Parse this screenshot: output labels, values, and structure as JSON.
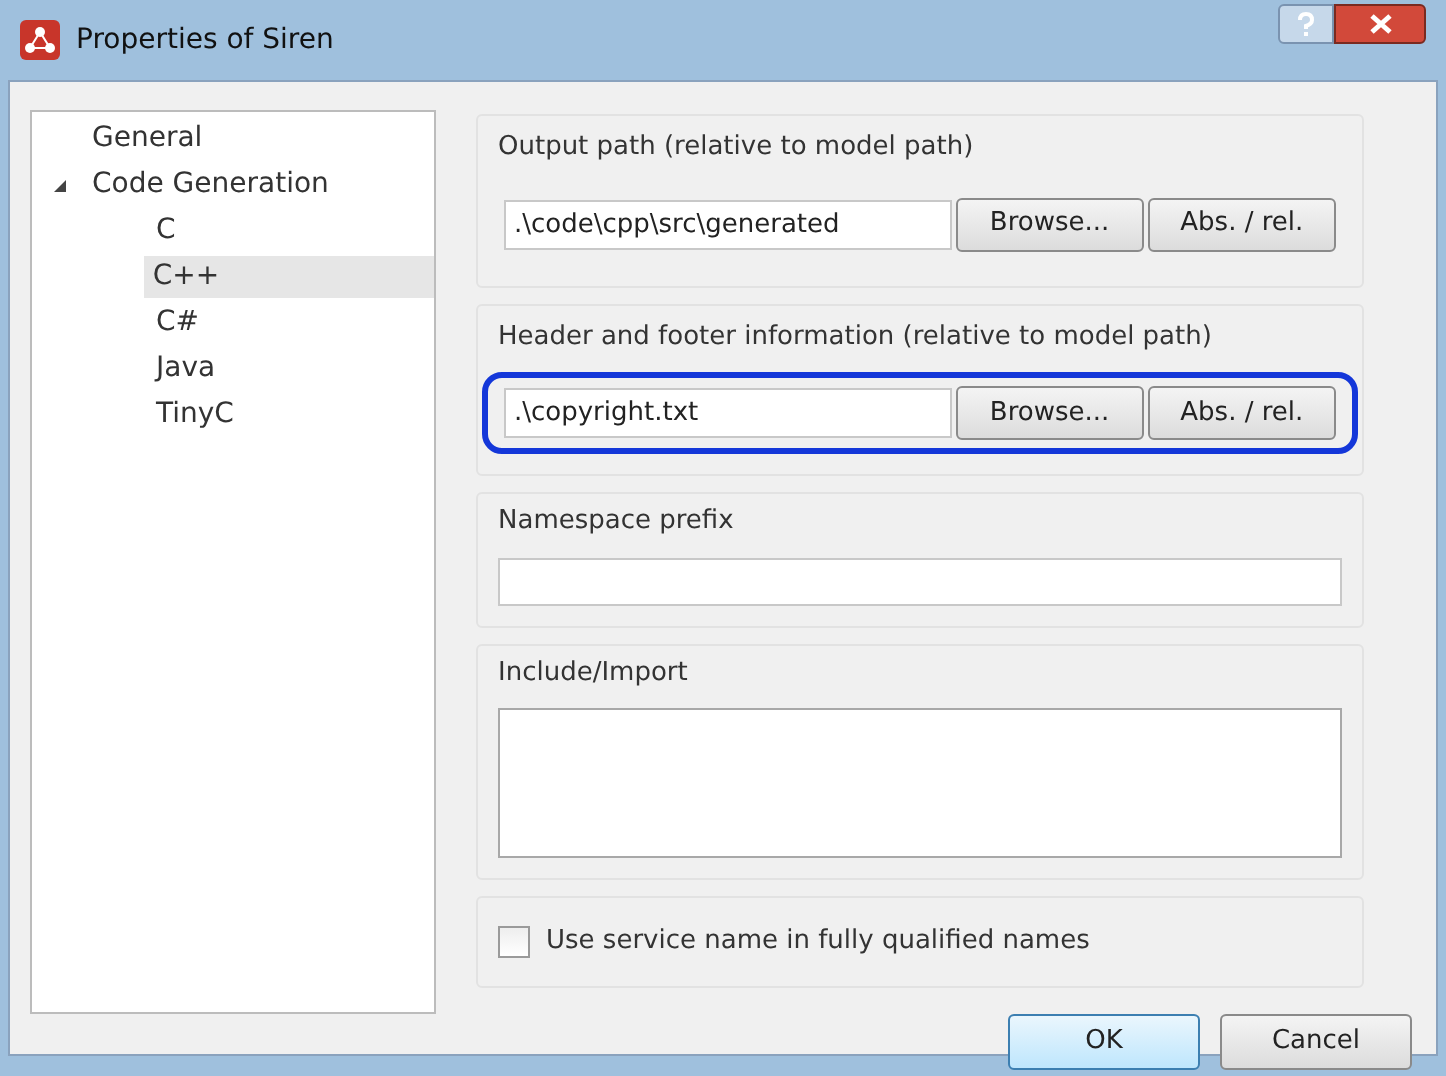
{
  "window": {
    "title": "Properties of Siren"
  },
  "tree": [
    {
      "label": "General",
      "selected": false
    },
    {
      "label": "Code Generation",
      "selected": false,
      "expanded": true,
      "children": [
        {
          "label": "C",
          "selected": false
        },
        {
          "label": "C++",
          "selected": true
        },
        {
          "label": "C#",
          "selected": false
        },
        {
          "label": "Java",
          "selected": false
        },
        {
          "label": "TinyC",
          "selected": false
        }
      ]
    }
  ],
  "output_path": {
    "label": "Output path (relative to model path)",
    "value": ".\\code\\cpp\\src\\generated",
    "browse": "Browse...",
    "abs_rel": "Abs. / rel."
  },
  "header_footer": {
    "label": "Header and footer information (relative to model path)",
    "value": ".\\copyright.txt",
    "browse": "Browse...",
    "abs_rel": "Abs. / rel.",
    "highlighted": true
  },
  "namespace_prefix": {
    "label": "Namespace prefix"
  },
  "include_import": {
    "label": "Include/Import"
  },
  "service_name": {
    "label": "Use service name in fully qualified names",
    "checked": false
  },
  "buttons": [
    {
      "label": "OK",
      "default": true
    },
    {
      "label": "Cancel",
      "default": false
    }
  ]
}
